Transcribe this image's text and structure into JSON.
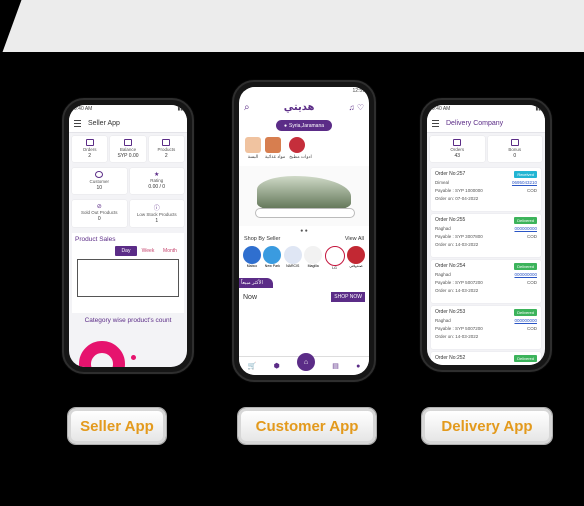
{
  "seller_app": {
    "status_time": "9:40 AM",
    "title": "Seller App",
    "stats": [
      {
        "label": "Orders",
        "value": "2"
      },
      {
        "label": "Balance",
        "value": "SYP 0.00"
      },
      {
        "label": "Products",
        "value": "2"
      }
    ],
    "stats2": [
      {
        "label": "Customer",
        "value": "10"
      },
      {
        "label": "Rating",
        "value": "0.00 / 0"
      }
    ],
    "stats3": [
      {
        "label": "Sold Out Products",
        "value": "0"
      },
      {
        "label": "Low Stock Products",
        "value": "1"
      }
    ],
    "product_sales": "Product Sales",
    "tabs": [
      "Day",
      "Week",
      "Month"
    ],
    "category_title": "Category wise product's count",
    "button_label": "Seller App"
  },
  "customer_app": {
    "status_time": "12:51",
    "brand": "هديتي",
    "location": "Syria,Jaramana",
    "categories": [
      "البسة",
      "مواد غذائية",
      "ادوات مطبخ"
    ],
    "shop_by_seller": "Shop By Seller",
    "view_all": "View All",
    "sellers": [
      "Mabco",
      "New Park",
      "NARCIS",
      "Magilla",
      "LG",
      "صندوقتي"
    ],
    "arabic_tag": "الأكثر مبيعاً",
    "now_label": "Now",
    "shop_now": "SHOP NOW",
    "button_label": "Customer App"
  },
  "delivery_app": {
    "status_time": "9:40 AM",
    "title": "Delivery Company",
    "stats": [
      {
        "label": "Orders",
        "value": "43"
      },
      {
        "label": "Bonus",
        "value": "0"
      }
    ],
    "orders": [
      {
        "no": "Order No:257",
        "status": "Received",
        "name": "Dimeal",
        "phone": "0695043210",
        "payable": "Payable : SYP 1000000",
        "method": "COD",
        "date": "Order on: 07-04-2022"
      },
      {
        "no": "Order No:255",
        "status": "Delivered",
        "name": "Raghad",
        "phone": "000000000",
        "payable": "Payable : SYP 3007800",
        "method": "COD",
        "date": "Order on: 14-03-2022"
      },
      {
        "no": "Order No:254",
        "status": "Delivered",
        "name": "Raghad",
        "phone": "000000000",
        "payable": "Payable : SYP 5007200",
        "method": "COD",
        "date": "Order on: 14-03-2022"
      },
      {
        "no": "Order No:253",
        "status": "Delivered",
        "name": "Raghad",
        "phone": "000000000",
        "payable": "Payable : SYP 5007200",
        "method": "COD",
        "date": "Order on: 14-03-2022"
      },
      {
        "no": "Order No:252",
        "status": "Delivered",
        "name": "",
        "phone": "",
        "payable": "",
        "method": "",
        "date": ""
      }
    ],
    "button_label": "Delivery App"
  },
  "colors": {
    "brand_purple": "#5b2c87",
    "received_blue": "#22b5d3",
    "delivered_green": "#3cb35b",
    "label_orange": "#e39a1d"
  }
}
